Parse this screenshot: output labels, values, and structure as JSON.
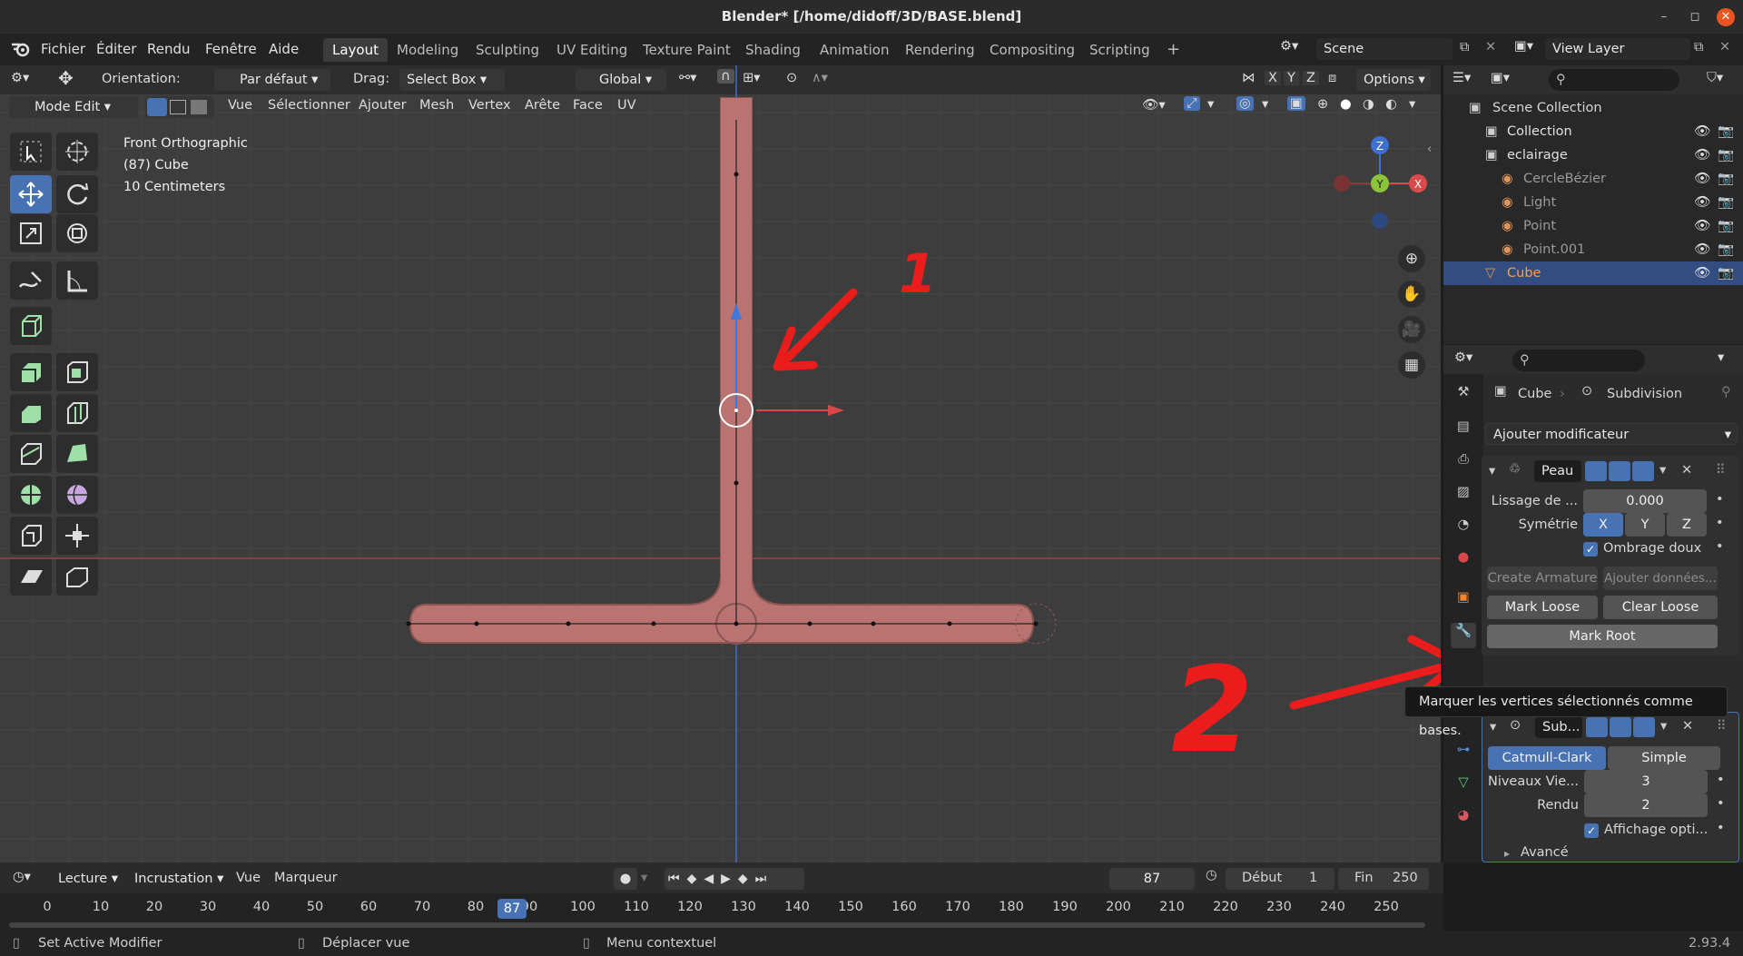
{
  "window": {
    "title": "Blender* [/home/didoff/3D/BASE.blend]"
  },
  "menu": [
    "Fichier",
    "Éditer",
    "Rendu",
    "Fenêtre",
    "Aide"
  ],
  "workspaces": [
    "Layout",
    "Modeling",
    "Sculpting",
    "UV Editing",
    "Texture Paint",
    "Shading",
    "Animation",
    "Rendering",
    "Compositing",
    "Scripting"
  ],
  "active_workspace": "Layout",
  "scene": {
    "label": "Scene",
    "view_layer": "View Layer"
  },
  "toolheader": {
    "orientation_label": "Orientation:",
    "orientation_value": "Par défaut",
    "drag_label": "Drag:",
    "drag_value": "Select Box",
    "transform_value": "Global",
    "axes": [
      "X",
      "Y",
      "Z"
    ],
    "options": "Options"
  },
  "viewheader": {
    "mode": "Mode Edit",
    "items": [
      "Vue",
      "Sélectionner",
      "Ajouter",
      "Mesh",
      "Vertex",
      "Arête",
      "Face",
      "UV"
    ]
  },
  "viewport": {
    "view_name": "Front Orthographic",
    "object_info": "(87) Cube",
    "scale_info": "10 Centimeters",
    "gizmo": {
      "z": "Z",
      "y": "Y",
      "x": "X"
    }
  },
  "annotations": {
    "one": "1",
    "two": "2"
  },
  "outliner": {
    "root": "Scene Collection",
    "items": [
      {
        "name": "Collection",
        "indent": 1
      },
      {
        "name": "eclairage",
        "indent": 1
      },
      {
        "name": "CercleBézier",
        "indent": 2
      },
      {
        "name": "Light",
        "indent": 2
      },
      {
        "name": "Point",
        "indent": 2
      },
      {
        "name": "Point.001",
        "indent": 2
      },
      {
        "name": "Cube",
        "indent": 1,
        "selected": true
      }
    ]
  },
  "properties": {
    "breadcrumb_object": "Cube",
    "breadcrumb_modifier": "Subdivision",
    "add_modifier": "Ajouter modificateur",
    "skin": {
      "name": "Peau",
      "smooth_label": "Lissage de ...",
      "smooth_value": "0.000",
      "sym_label": "Symétrie",
      "sym": [
        "X",
        "Y",
        "Z"
      ],
      "smooth_shading": "Ombrage doux",
      "create_armature": "Create Armature",
      "add_data": "Ajouter données...",
      "mark_loose": "Mark Loose",
      "clear_loose": "Clear Loose",
      "mark_root": "Mark Root"
    },
    "tooltip": "Marquer les vertices sélectionnés comme bases.",
    "subsurf": {
      "name": "Sub...",
      "catmull": "Catmull-Clark",
      "simple": "Simple",
      "levels_label": "Niveaux Vie...",
      "levels_value": "3",
      "render_label": "Rendu",
      "render_value": "2",
      "optimal": "Affichage opti...",
      "advanced": "Avancé"
    }
  },
  "timeline": {
    "menus": [
      "Lecture",
      "Incrustation",
      "Vue",
      "Marqueur"
    ],
    "current_frame": "87",
    "start_label": "Début",
    "start": "1",
    "end_label": "Fin",
    "end": "250",
    "ticks": [
      "0",
      "10",
      "20",
      "30",
      "40",
      "50",
      "60",
      "70",
      "80",
      "90",
      "100",
      "110",
      "120",
      "130",
      "140",
      "150",
      "160",
      "170",
      "180",
      "190",
      "200",
      "210",
      "220",
      "230",
      "240",
      "250"
    ]
  },
  "status": {
    "left": "Set Active Modifier",
    "mid": "Déplacer vue",
    "right": "Menu contextuel",
    "version": "2.93.4"
  }
}
